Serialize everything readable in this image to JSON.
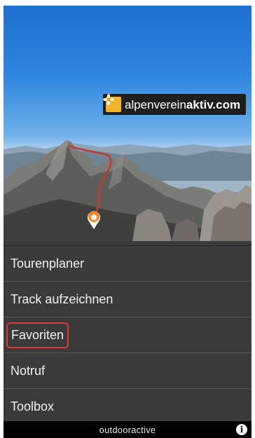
{
  "hero": {
    "brand_plain": "alpenverein",
    "brand_bold": "aktiv.com",
    "brand_logo_icon": "edelweiss-icon",
    "marker_icon": "home-pin-icon"
  },
  "menu": {
    "items": [
      {
        "label": "Tourenplaner"
      },
      {
        "label": "Track aufzeichnen"
      },
      {
        "label": "Favoriten",
        "highlighted": true
      },
      {
        "label": "Notruf"
      },
      {
        "label": "Toolbox"
      }
    ]
  },
  "footer": {
    "brand": "outdooractive",
    "info_icon": "info-icon"
  },
  "colors": {
    "menu_bg": "#3a3a3a",
    "highlight": "#d63b3b",
    "badge_logo": "#f2b52a",
    "route": "#c0392b",
    "marker": "#f08a24"
  }
}
